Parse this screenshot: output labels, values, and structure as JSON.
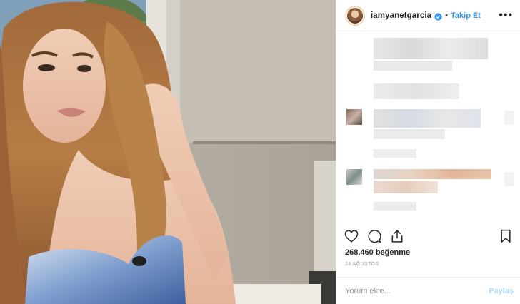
{
  "post": {
    "username": "iamyanetgarcia",
    "separator": "•",
    "follow_label": "Takip Et",
    "more_label": "•••",
    "likes": "268.460 beğenme",
    "date": "18 AĞUSTOS",
    "comment_placeholder": "Yorum ekle...",
    "share_label": "Paylaş"
  },
  "colors": {
    "accent": "#3897f0",
    "share_disabled": "#b3dbff",
    "verified": "#3897f0"
  },
  "icons": {
    "like": "heart-icon",
    "comment": "comment-icon",
    "share": "share-icon",
    "save": "bookmark-icon",
    "verified": "verified-badge-icon",
    "more": "more-options-icon"
  }
}
